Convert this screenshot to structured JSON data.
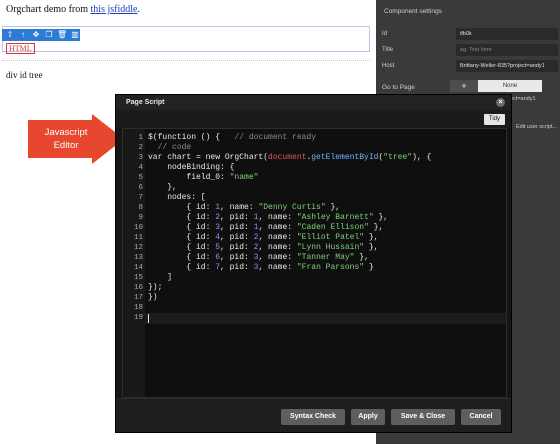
{
  "page": {
    "intro_text": "Orgchart demo from ",
    "intro_link": "this jsfiddle",
    "intro_suffix": ".",
    "html_chip": "HTML",
    "div_text": "div id tree",
    "mini_toolbar": [
      "arrow-up-icon",
      "arrow-up-icon",
      "move-icon",
      "copy-icon",
      "trash-icon",
      "grid-icon"
    ]
  },
  "settings": {
    "title": "Component settings",
    "rows": [
      {
        "label": "Id",
        "value": "ifb0k",
        "placeholder": false
      },
      {
        "label": "Title",
        "value": "eg. Text here",
        "placeholder": true
      },
      {
        "label": "Host",
        "value": "Brittany-Weller-835?project=andy1",
        "placeholder": false
      }
    ],
    "goto_label": "Go to Page",
    "plus_label": "+",
    "none_label": "None",
    "project_text": "ect=andy1",
    "edit_link": "Edit user script..."
  },
  "callout": {
    "line1": "Javascript",
    "line2": "Editor",
    "color": "#e8472f"
  },
  "modal": {
    "title": "Page Script",
    "close": "×",
    "tidy": "Tidy",
    "buttons": {
      "syntax": "Syntax Check",
      "apply": "Apply",
      "save_close": "Save & Close",
      "cancel": "Cancel"
    }
  },
  "code_lines": [
    {
      "n": "1",
      "html": "$(function () {   <span class=\"cm\">// document ready</span>"
    },
    {
      "n": "2",
      "html": "  <span class=\"cm\">// code</span>"
    },
    {
      "n": "3",
      "html": "var chart = new OrgChart(<span class=\"dom\">document</span>.<span class=\"fn\">getElementById</span>(<span class=\"str\">\"tree\"</span>), {"
    },
    {
      "n": "4",
      "html": "    nodeBinding: {"
    },
    {
      "n": "5",
      "html": "        field_0: <span class=\"str\">\"name\"</span>"
    },
    {
      "n": "6",
      "html": "    },"
    },
    {
      "n": "7",
      "html": "    nodes: ["
    },
    {
      "n": "8",
      "html": "        { id: <span class=\"num\">1</span>, name: <span class=\"str\">\"Denny Curtis\"</span> },"
    },
    {
      "n": "9",
      "html": "        { id: <span class=\"num\">2</span>, pid: <span class=\"num\">1</span>, name: <span class=\"str\">\"Ashley Barnett\"</span> },"
    },
    {
      "n": "10",
      "html": "        { id: <span class=\"num\">3</span>, pid: <span class=\"num\">1</span>, name: <span class=\"str\">\"Caden Ellison\"</span> },"
    },
    {
      "n": "11",
      "html": "        { id: <span class=\"num\">4</span>, pid: <span class=\"num\">2</span>, name: <span class=\"str\">\"Elliot Patel\"</span> },"
    },
    {
      "n": "12",
      "html": "        { id: <span class=\"num\">5</span>, pid: <span class=\"num\">2</span>, name: <span class=\"str\">\"Lynn Hussain\"</span> },"
    },
    {
      "n": "13",
      "html": "        { id: <span class=\"num\">6</span>, pid: <span class=\"num\">3</span>, name: <span class=\"str\">\"Tanner May\"</span> },"
    },
    {
      "n": "14",
      "html": "        { id: <span class=\"num\">7</span>, pid: <span class=\"num\">3</span>, name: <span class=\"str\">\"Fran Parsons\"</span> }"
    },
    {
      "n": "15",
      "html": "    ]"
    },
    {
      "n": "16",
      "html": "});"
    },
    {
      "n": "17",
      "html": "})"
    },
    {
      "n": "18",
      "html": ""
    },
    {
      "n": "19",
      "html": ""
    }
  ]
}
